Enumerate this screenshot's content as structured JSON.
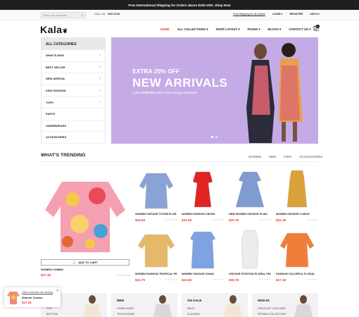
{
  "topbar": {
    "promo": "Free International Shipping for Orders above $100 USD. Shop Now"
  },
  "util": {
    "search_placeholder": "Enter your keywords ...",
    "call_label": "CALL US:",
    "call_number": "1900-6789",
    "shipping": "Free Shipping for all orders!",
    "login": "LOGIN",
    "register": "REGISTER",
    "currency": "USD $"
  },
  "header": {
    "logo": "Kala",
    "nav": [
      "HOME",
      "ALL COLLECTIONS",
      "SHOP LAYOUT",
      "PAGES",
      "BLOGS",
      "CONTACT US"
    ],
    "cart_count": "0"
  },
  "sidebar": {
    "title": "ALL CATEGORIES",
    "items": [
      "WHAT'S NEW",
      "BEST SELLER",
      "NEW ARRIVAL",
      "KIDS FASHION",
      "TOPS",
      "PANTS",
      "UNDERWEARS",
      "ACCESSORIES"
    ]
  },
  "hero": {
    "subtitle": "EXTRA 20% OFF",
    "title": "NEW ARRIVALS",
    "code_prefix": "Code",
    "code": "FORYOU",
    "code_suffix": "purus class congue praesent"
  },
  "trending": {
    "title": "WHAT'S TRENDING",
    "tabs": [
      "WOMEN",
      "MEN",
      "KIDS",
      "ACCESSORIES"
    ],
    "add_to_cart": "ADD TO CART",
    "featured": {
      "name": "WOMEN COMBO",
      "price": "$27.18"
    },
    "products": [
      {
        "name": "WOMEN VINTAGE TOTEM FLOR...",
        "price": "$34.54",
        "color": "#8aa3d6"
      },
      {
        "name": "WOMEN FASHION CROSS",
        "price": "$31.08",
        "color": "#e02424"
      },
      {
        "name": "NEW WOMEN VINTAGE PLAID",
        "price": "$30.78",
        "color": "#7f9bd0"
      },
      {
        "name": "WOMEN VINTAGE V-NECK",
        "price": "$32.18",
        "color": "#d9a23a"
      },
      {
        "name": "WOMEN FASHION TROPICAL FR...",
        "price": "$22.70",
        "color": "#e4b96a"
      },
      {
        "name": "WOMEN VINTAGE CHAIN",
        "price": "$24.60",
        "color": "#7fa2e0"
      },
      {
        "name": "VINTAGE POSITION FLORAL PRI...",
        "price": "$30.78",
        "color": "#ececec"
      },
      {
        "name": "FASHION COLORFUL FLORAL",
        "price": "$27.18",
        "color": "#f07e3a"
      }
    ]
  },
  "bottom": [
    {
      "title": "",
      "items": [
        "TOP",
        "BOTTOM"
      ]
    },
    {
      "title": "MEN",
      "items": [
        "HOME AUDIO",
        "TELEVISIONS"
      ]
    },
    {
      "title": "ON SALE",
      "items": [
        "BAGS",
        "GLASSES"
      ]
    },
    {
      "title": "NEW IN",
      "items": [
        "DISCOUNT VOUCHER",
        "SPRING COLLECTION"
      ]
    }
  ],
  "popup": {
    "label": "Other customer are viewing",
    "name": "Women Combo",
    "price": "$27.18"
  },
  "colors": {
    "accent": "#e33",
    "hero_bg": "#c5abe6"
  }
}
